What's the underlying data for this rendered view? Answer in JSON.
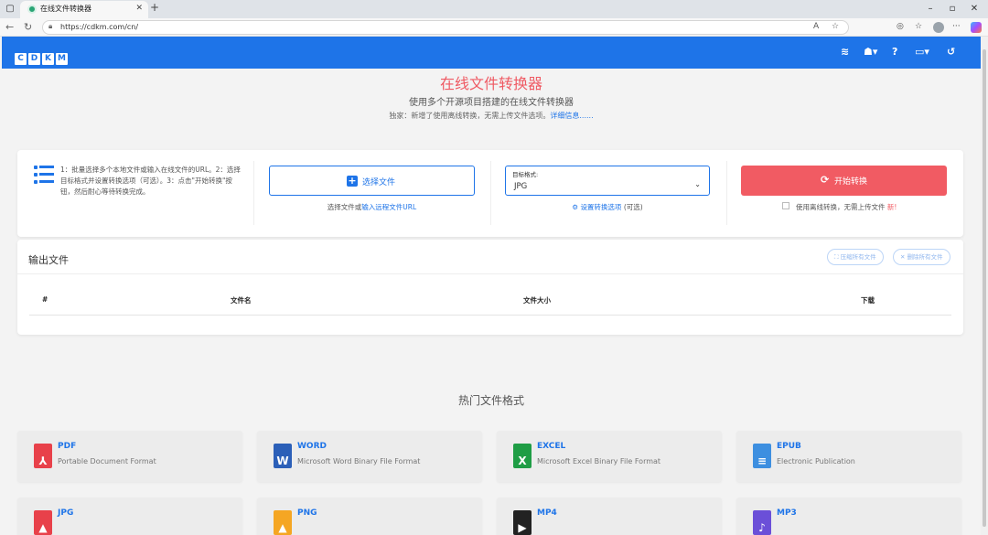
{
  "browser": {
    "tab_title": "在线文件转换器",
    "url": "https://cdkm.com/cn/"
  },
  "site": {
    "logo_letters": [
      "C",
      "D",
      "K",
      "M"
    ],
    "nav_icons": [
      "layers-icon",
      "robot-icon",
      "help-icon",
      "language-icon",
      "history-icon"
    ]
  },
  "hero": {
    "title": "在线文件转换器",
    "subtitle": "使用多个开源项目搭建的在线文件转换器",
    "note": "独家：新增了使用离线转换，无需上传文件选项。",
    "note_link": "详细信息......"
  },
  "converter": {
    "steps": "1：批量选择多个本地文件或输入在线文件的URL。2：选择目标格式并设置转换选项（可选）。3：点击\"开始转换\"按钮，然后耐心等待转换完成。",
    "select_file_label": "选择文件",
    "select_file_note_prefix": "选择文件或",
    "select_file_note_link": "输入远程文件URL",
    "target_format_label": "目标格式:",
    "target_format_value": "JPG",
    "options_link": "设置转换选项",
    "options_suffix": "(可选)",
    "start_label": "开始转换",
    "offline_label": "使用离线转换，无需上传文件",
    "new_badge": "新!"
  },
  "output": {
    "title": "输出文件",
    "zip_all_label": "压缩所有文件",
    "delete_all_label": "删除所有文件",
    "columns": [
      "#",
      "文件名",
      "文件大小",
      "下载"
    ]
  },
  "popular": {
    "title": "热门文件格式",
    "formats": [
      {
        "name": "PDF",
        "desc": "Portable Document Format",
        "color": "#e8414a",
        "icon": "pdf-icon"
      },
      {
        "name": "WORD",
        "desc": "Microsoft Word Binary File Format",
        "color": "#2b5fb8",
        "icon": "word-icon"
      },
      {
        "name": "EXCEL",
        "desc": "Microsoft Excel Binary File Format",
        "color": "#1f9d45",
        "icon": "excel-icon"
      },
      {
        "name": "EPUB",
        "desc": "Electronic Publication",
        "color": "#3d8fe0",
        "icon": "epub-icon"
      },
      {
        "name": "JPG",
        "desc": "",
        "color": "#e8414a",
        "icon": "jpg-icon"
      },
      {
        "name": "PNG",
        "desc": "",
        "color": "#f5a623",
        "icon": "png-icon"
      },
      {
        "name": "MP4",
        "desc": "",
        "color": "#222222",
        "icon": "mp4-icon"
      },
      {
        "name": "MP3",
        "desc": "",
        "color": "#6b4fd8",
        "icon": "mp3-icon"
      }
    ]
  },
  "colors": {
    "brand": "#1e74e8",
    "accent": "#f15b63"
  }
}
